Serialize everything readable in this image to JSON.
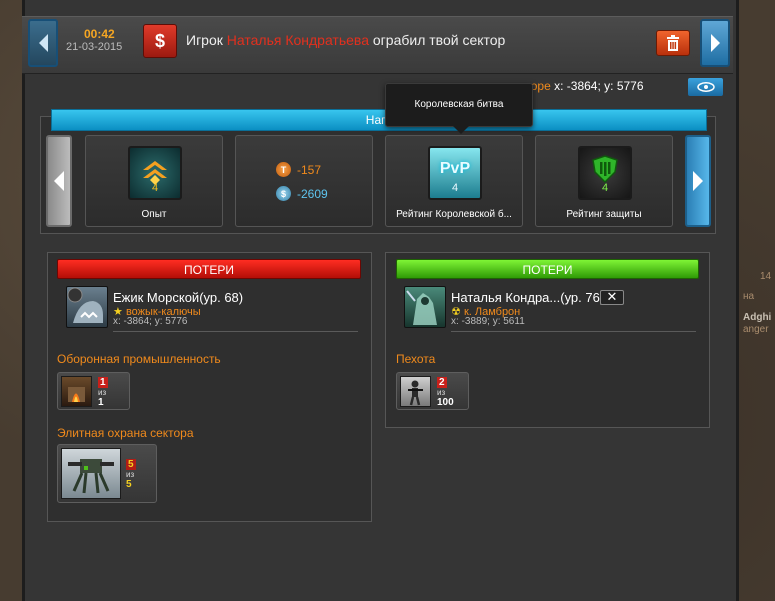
{
  "header": {
    "time": "00:42",
    "date": "21-03-2015",
    "message_prefix": "Игрок",
    "message_player": "Наталья Кондратьева",
    "message_suffix": "ограбил твой сектор"
  },
  "coords_row": {
    "label": "кторе",
    "value": "x: -3864; y: 5776"
  },
  "tooltip": {
    "text": "Королевская битва"
  },
  "rewards": {
    "bar_label": "Нагр",
    "cards": [
      {
        "caption": "Опыт",
        "count": "4",
        "icon": "rank-chevron-icon"
      },
      {
        "res_t": "-157",
        "res_s": "-2609"
      },
      {
        "caption": "Рейтинг Королевской б...",
        "count": "4",
        "icon": "pvp-icon",
        "badge_text": "PvP"
      },
      {
        "caption": "Рейтинг защиты",
        "count": "4",
        "icon": "shield-icon"
      }
    ]
  },
  "left_panel": {
    "header": "ПОТЕРИ",
    "player_name": "Ежик Морской(ур. 68)",
    "alliance": "вожык-калючы",
    "coords": "x: -3864; y: 5776",
    "sections": [
      {
        "title": "Оборонная промышленность",
        "lost": "1",
        "of": "из",
        "total": "1"
      },
      {
        "title": "Элитная охрана сектора",
        "lost": "5",
        "of": "из",
        "total": "5"
      }
    ]
  },
  "right_panel": {
    "header": "ПОТЕРИ",
    "player_name": "Наталья Кондра...(ур. 76)",
    "alliance": "к. Ламброн",
    "coords": "x: -3889; y: 5611",
    "close_label": "✕",
    "sections": [
      {
        "title": "Пехота",
        "lost": "2",
        "of": "из",
        "total": "100"
      }
    ]
  },
  "side_texts": {
    "t1": "14",
    "t2": "на",
    "t3": "Adghi",
    "t4": "anger"
  },
  "colors": {
    "accent_orange": "#f08a1c",
    "loss_red": "#e2301e",
    "loss_green": "#4fc21a",
    "blue_button": "#1f6ea3"
  }
}
